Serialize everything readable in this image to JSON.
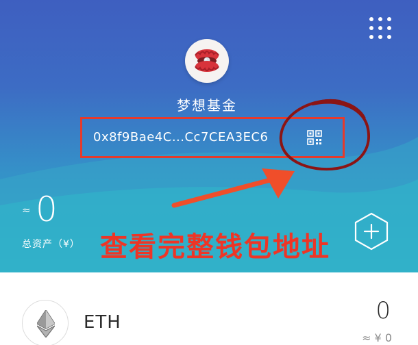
{
  "header": {
    "menu_icon": "grid-dots-icon"
  },
  "wallet": {
    "avatar_icon": "oyster-pearl-avatar",
    "name": "梦想基金",
    "address": "0x8f9Bae4C...Cc7CEA3EC6",
    "qr_icon": "qr-code-icon"
  },
  "balance": {
    "approx_sign": "≈",
    "value": "0",
    "label": "总资产（¥）"
  },
  "annotation": {
    "text": "查看完整钱包地址",
    "color": "#ee3526"
  },
  "actions": {
    "add_icon": "add-token-hexagon-icon"
  },
  "tokens": [
    {
      "icon": "ethereum-icon",
      "symbol": "ETH",
      "amount": "0",
      "fiat_value": "≈ ¥ 0"
    }
  ],
  "colors": {
    "header_top": "#3e5fc0",
    "header_bottom": "#2fb3c9",
    "highlight_red": "#e63a2b",
    "circle_mark": "#8b1414"
  }
}
